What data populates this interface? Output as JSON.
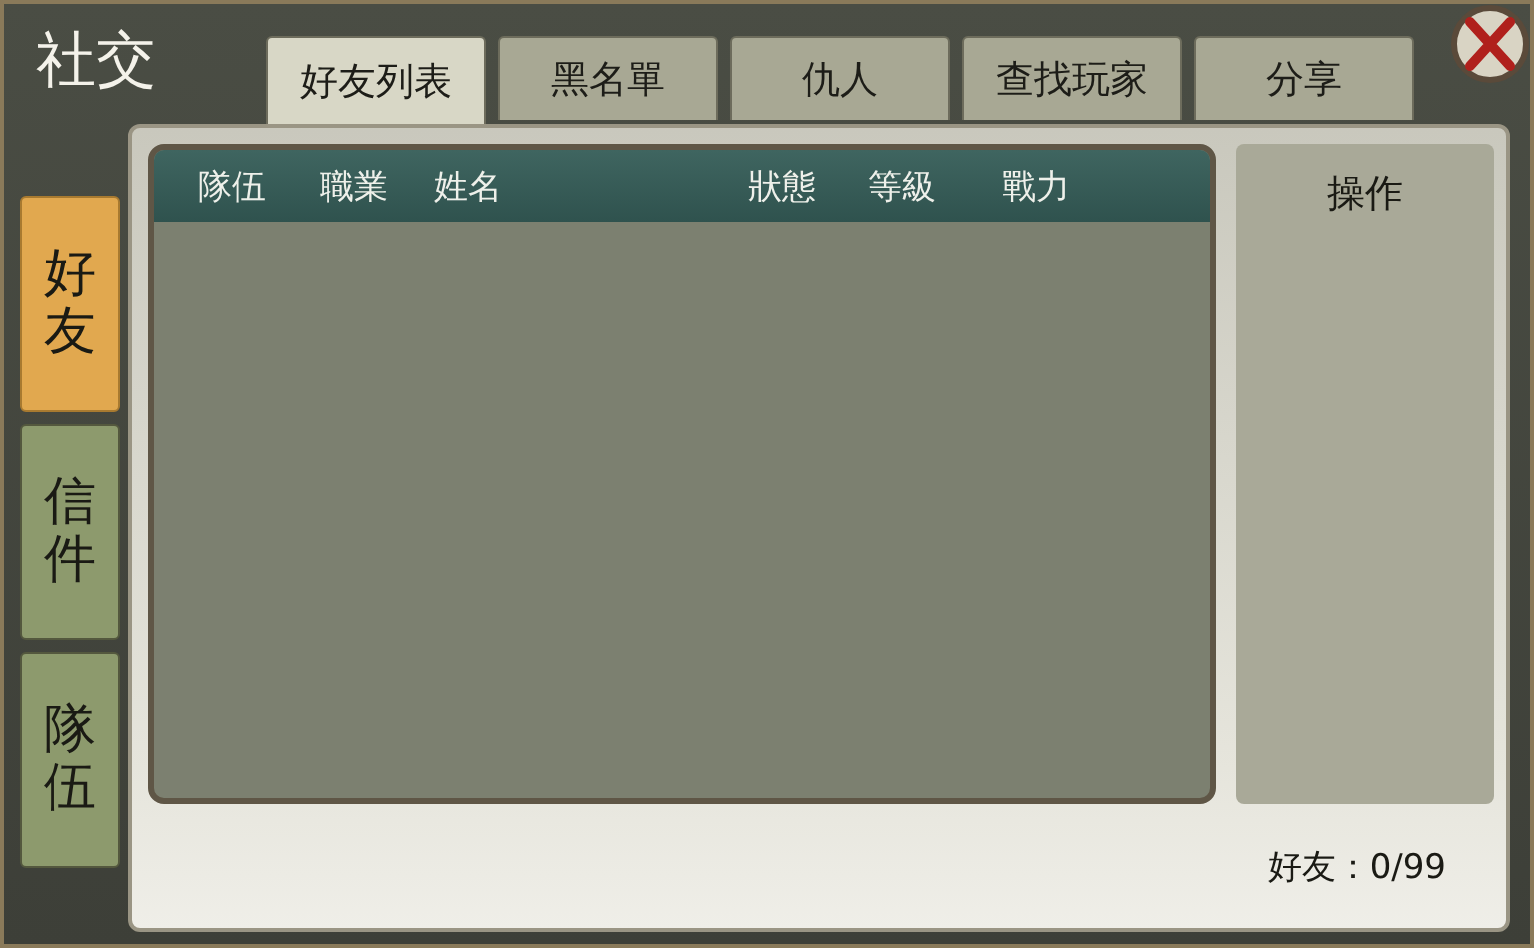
{
  "window": {
    "title": "社交"
  },
  "tabs": [
    {
      "label": "好友列表",
      "selected": true
    },
    {
      "label": "黑名單",
      "selected": false
    },
    {
      "label": "仇人",
      "selected": false
    },
    {
      "label": "查找玩家",
      "selected": false
    },
    {
      "label": "分享",
      "selected": false
    }
  ],
  "side_tabs": [
    {
      "label": "好友",
      "selected": true
    },
    {
      "label": "信件",
      "selected": false
    },
    {
      "label": "隊伍",
      "selected": false
    }
  ],
  "table": {
    "columns": [
      "隊伍",
      "職業",
      "姓名",
      "狀態",
      "等級",
      "戰力"
    ]
  },
  "actions_panel": {
    "title": "操作"
  },
  "footer": {
    "friend_count": "好友：0/99"
  }
}
